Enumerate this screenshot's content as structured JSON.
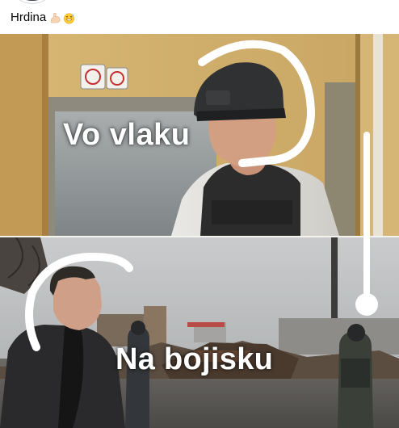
{
  "post": {
    "caption": "Hrdina",
    "emojis": [
      "flexed-biceps-emoji",
      "grinning-sweat-emoji"
    ]
  },
  "meme": {
    "top_caption": "Vo vlaku",
    "bottom_caption": "Na bojisku"
  }
}
